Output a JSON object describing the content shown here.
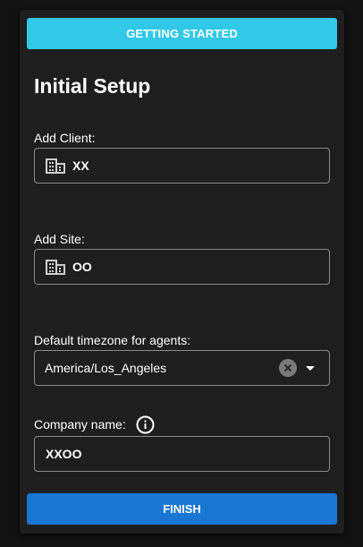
{
  "header": {
    "button_label": "GETTING STARTED"
  },
  "title": "Initial Setup",
  "client": {
    "label": "Add Client:",
    "value": "XX",
    "icon": "building-icon"
  },
  "site": {
    "label": "Add Site:",
    "value": "OO",
    "icon": "building-icon"
  },
  "timezone": {
    "label": "Default timezone for agents:",
    "value": "America/Los_Angeles"
  },
  "company": {
    "label": "Company name:",
    "value": "XXOO",
    "icon": "info-icon"
  },
  "footer": {
    "finish_label": "FINISH"
  },
  "colors": {
    "header_button": "#32c8e8",
    "finish_button": "#1976d2",
    "card": "#1e1e1e",
    "background": "#121212"
  }
}
